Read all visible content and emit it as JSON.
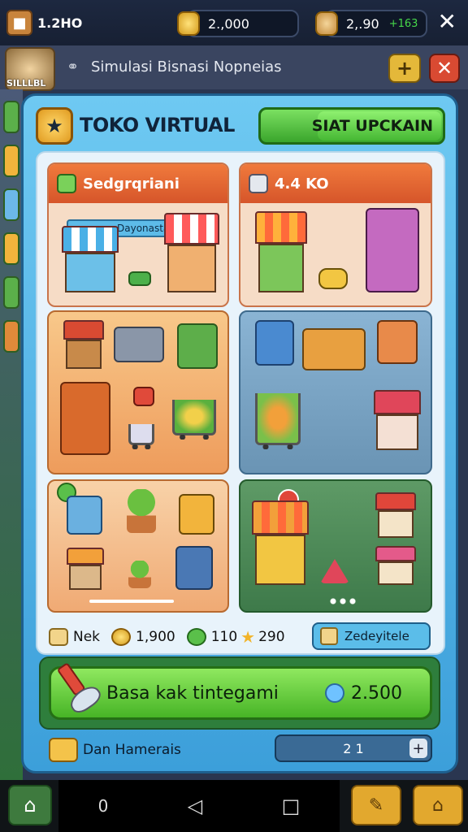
{
  "topbar": {
    "level_label": "1.2HO",
    "coins": "2.,000",
    "gems": "2,.90",
    "gems_bonus": "+163"
  },
  "titlebar": {
    "avatar_label": "SILLLBL",
    "title": "Simulasi Bisnasi Nopneias"
  },
  "panel": {
    "title": "TOKO VIRTUAL",
    "upgrade_button": "SIAT UPCKAIN"
  },
  "cards": [
    {
      "title": "Sedgrqriani",
      "tag": "Dayonasta"
    },
    {
      "title": "4.4 KO"
    }
  ],
  "stats": {
    "store_label": "Nek",
    "coins": "1,900",
    "items": "110",
    "stars": "290",
    "detail_button": "Zedeyitele"
  },
  "action": {
    "label": "Basa kak tintegami",
    "cost": "2.500"
  },
  "footer": {
    "label": "Dan Hamerais",
    "quantity": "2 1"
  },
  "colors": {
    "panel_blue": "#3c9fda",
    "accent_green": "#47b426",
    "header_orange": "#e0612e"
  }
}
